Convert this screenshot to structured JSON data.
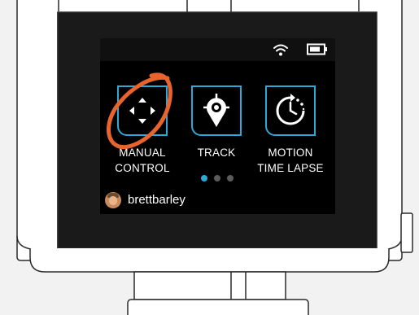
{
  "screen": {
    "status_icons": [
      "wifi-icon",
      "battery-icon"
    ],
    "modes": [
      {
        "label": "MANUAL\nCONTROL",
        "icon": "directional-pad-icon"
      },
      {
        "label": "TRACK",
        "icon": "location-pin-icon"
      },
      {
        "label": "MOTION\nTIME LAPSE",
        "icon": "clock-timelapse-icon"
      }
    ],
    "pages": {
      "total": 3,
      "current": 1
    },
    "user": {
      "name": "brettbarley"
    }
  },
  "colors": {
    "accent": "#2ea8d6",
    "highlight_circle": "#e8642c",
    "screen_bg": "#000000",
    "device_bezel": "#1a1a1a"
  }
}
